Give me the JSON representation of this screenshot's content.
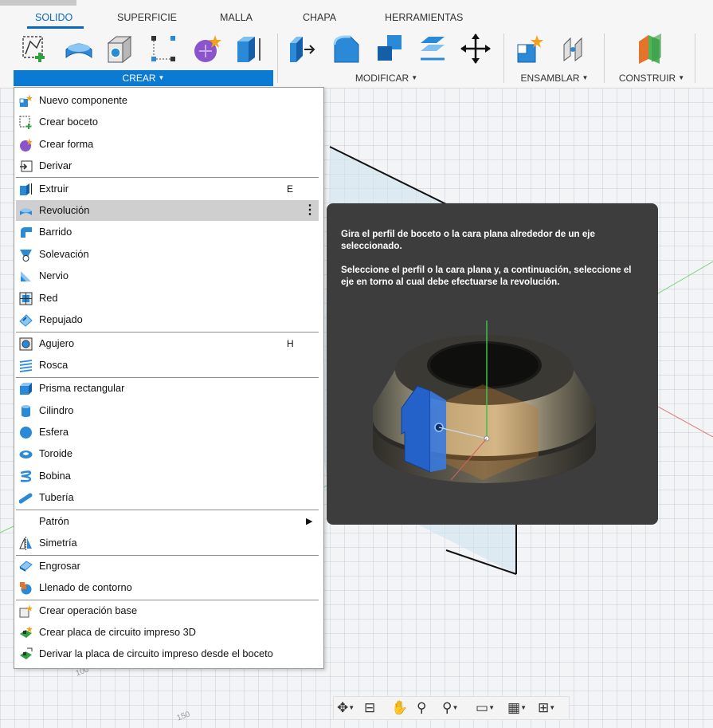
{
  "tabs": [
    "SOLIDO",
    "SUPERFICIE",
    "MALLA",
    "CHAPA",
    "HERRAMIENTAS"
  ],
  "groups": {
    "crear": "CREAR",
    "modificar": "MODIFICAR",
    "ensamblar": "ENSAMBLAR",
    "construir": "CONSTRUIR"
  },
  "toolbar_icons": [
    "create-sketch-icon",
    "revolve-icon",
    "box-icon",
    "construction-icon",
    "create-form-icon",
    "extrude-icon",
    "press-pull-icon",
    "fillet-icon",
    "combine-icon",
    "offset-face-icon",
    "move-icon",
    "new-component-icon",
    "joint-icon",
    "plane-icon"
  ],
  "menu": {
    "items": [
      {
        "label": "Nuevo componente",
        "icon": "new-component-icon"
      },
      {
        "label": "Crear boceto",
        "icon": "create-sketch-icon"
      },
      {
        "label": "Crear forma",
        "icon": "create-form-icon"
      },
      {
        "label": "Derivar",
        "icon": "derive-icon"
      },
      {
        "label": "Extruir",
        "icon": "extrude-icon",
        "shortcut": "E"
      },
      {
        "label": "Revolución",
        "icon": "revolve-icon",
        "highlighted": true
      },
      {
        "label": "Barrido",
        "icon": "sweep-icon"
      },
      {
        "label": "Solevación",
        "icon": "loft-icon"
      },
      {
        "label": "Nervio",
        "icon": "rib-icon"
      },
      {
        "label": "Red",
        "icon": "web-icon"
      },
      {
        "label": "Repujado",
        "icon": "emboss-icon"
      },
      {
        "label": "Agujero",
        "icon": "hole-icon",
        "shortcut": "H"
      },
      {
        "label": "Rosca",
        "icon": "thread-icon"
      },
      {
        "label": "Prisma rectangular",
        "icon": "box-icon"
      },
      {
        "label": "Cilindro",
        "icon": "cylinder-icon"
      },
      {
        "label": "Esfera",
        "icon": "sphere-icon"
      },
      {
        "label": "Toroide",
        "icon": "torus-icon"
      },
      {
        "label": "Bobina",
        "icon": "coil-icon"
      },
      {
        "label": "Tubería",
        "icon": "pipe-icon"
      },
      {
        "label": "Patrón",
        "icon": "",
        "submenu": true
      },
      {
        "label": "Simetría",
        "icon": "mirror-icon"
      },
      {
        "label": "Engrosar",
        "icon": "thicken-icon"
      },
      {
        "label": "Llenado de contorno",
        "icon": "boundary-fill-icon"
      },
      {
        "label": "Crear operación base",
        "icon": "base-feature-icon"
      },
      {
        "label": "Crear placa de circuito impreso 3D",
        "icon": "pcb-icon"
      },
      {
        "label": "Derivar la placa de circuito impreso desde el boceto",
        "icon": "derive-pcb-icon"
      }
    ]
  },
  "tooltip": {
    "p1": "Gira el perfil de boceto o la cara plana alrededor de un eje seleccionado.",
    "p2": "Seleccione el perfil o la cara plana y, a continuación, seleccione el eje en torno al cual debe efectuarse la revolución."
  },
  "viewport": {
    "ruler_labels": [
      "100",
      "150"
    ]
  },
  "navbar_icons": [
    "orbit-icon",
    "look-at-icon",
    "pan-icon",
    "zoom-icon",
    "fit-icon",
    "display-settings-icon",
    "grid-icon",
    "viewports-icon"
  ],
  "colors": {
    "accent": "#0a7ad2",
    "tooltip_bg": "#3d3d3d",
    "highlight": "#cfcfcf"
  }
}
